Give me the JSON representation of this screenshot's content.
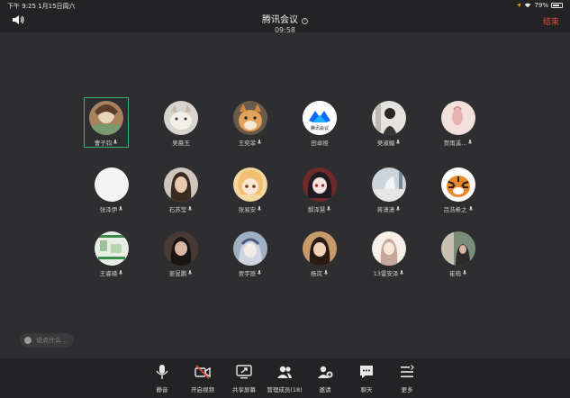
{
  "status_bar": {
    "time_date": "下午 9:25  1月15日周六",
    "battery": "79%",
    "battery_level": 0.79
  },
  "header": {
    "title": "腾讯会议",
    "timer": "09:58",
    "end_label": "结束"
  },
  "participants": [
    {
      "name": "曹子钧"
    },
    {
      "name": "吴晨玉"
    },
    {
      "name": "王奕菲"
    },
    {
      "name": "田卓娅",
      "logo_text": "腾讯会议"
    },
    {
      "name": "吴淑媚"
    },
    {
      "name": "贺雨溪..."
    },
    {
      "name": "张泽伊"
    },
    {
      "name": "石苏莹"
    },
    {
      "name": "张易安"
    },
    {
      "name": "郝泽慧"
    },
    {
      "name": "蒋潇潇"
    },
    {
      "name": "吕浩希之"
    },
    {
      "name": "王睿瑛"
    },
    {
      "name": "姜昱鹏"
    },
    {
      "name": "贾宇辰"
    },
    {
      "name": "杨岚"
    },
    {
      "name": "13雷安泽"
    },
    {
      "name": "崔萌"
    }
  ],
  "chat": {
    "placeholder": "说点什么..."
  },
  "toolbar": {
    "mute": "静音",
    "video": "开启视频",
    "share": "共享屏幕",
    "members": "管理成员(18)",
    "invite": "邀请",
    "chat": "聊天",
    "more": "更多"
  },
  "colors": {
    "accent_green": "#3bb370",
    "end_red": "#e84a3f",
    "tencent_blue": "#0a6cff",
    "video_off_red": "#e84a3f"
  }
}
